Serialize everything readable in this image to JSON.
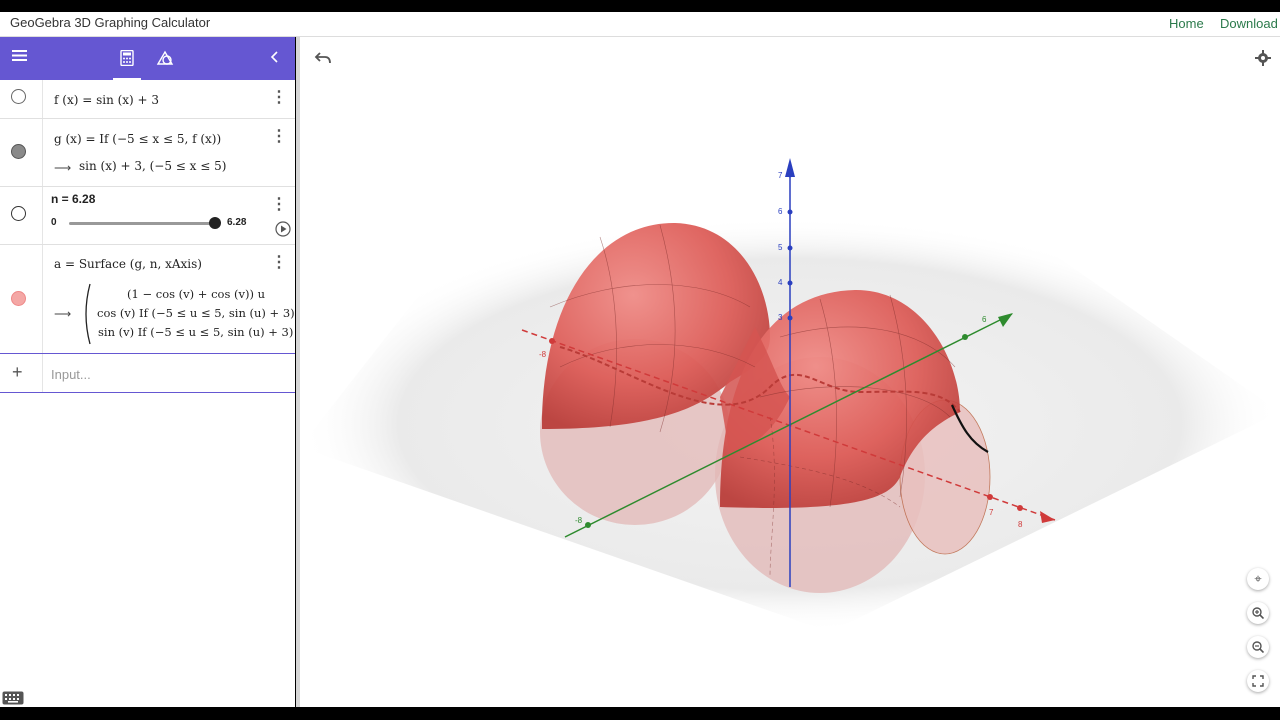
{
  "app": {
    "title": "GeoGebra 3D Graphing Calculator"
  },
  "nav": {
    "home": "Home",
    "download": "Download"
  },
  "algebra": {
    "f_expr": "f (x)  =  sin (x) + 3",
    "g_expr": "g (x)  =  If (−5 ≤ x ≤ 5, f (x))",
    "g_result": "sin (x) + 3,     (−5 ≤ x ≤ 5)",
    "n_label": "n = 6.28",
    "slider_min": "0",
    "slider_max": "6.28",
    "slider_value_fraction": 1.0,
    "a_expr": "a = Surface (g, n, xAxis)",
    "a_row1": "(1 − cos (v) + cos (v))  u",
    "a_row2": "cos (v)  If (−5 ≤ u ≤ 5, sin (u) + 3)",
    "a_row3": "sin (v)  If (−5 ≤ u ≤ 5, sin (u) + 3)",
    "input_placeholder": "Input..."
  },
  "axis_ticks": {
    "z": [
      "7",
      "6",
      "5",
      "4",
      "3"
    ],
    "x_pos": [
      "7",
      "8"
    ],
    "x_neg": [
      "-8"
    ],
    "y_pos": [
      "6"
    ],
    "y_neg": [
      "-8"
    ]
  },
  "colors": {
    "header": "#6557d2",
    "surface": "#d9534f",
    "x_axis": "#d03a3a",
    "y_axis": "#2e8b2e",
    "z_axis": "#2a3fbf",
    "accent_link": "#2b7a4b"
  },
  "icons": [
    "menu-icon",
    "calculator-icon",
    "tools-icon",
    "collapse-icon",
    "undo-icon",
    "settings-icon",
    "play-icon",
    "add-icon",
    "keyboard-icon",
    "center-view-icon",
    "zoom-in-icon",
    "zoom-out-icon",
    "fullscreen-icon"
  ]
}
